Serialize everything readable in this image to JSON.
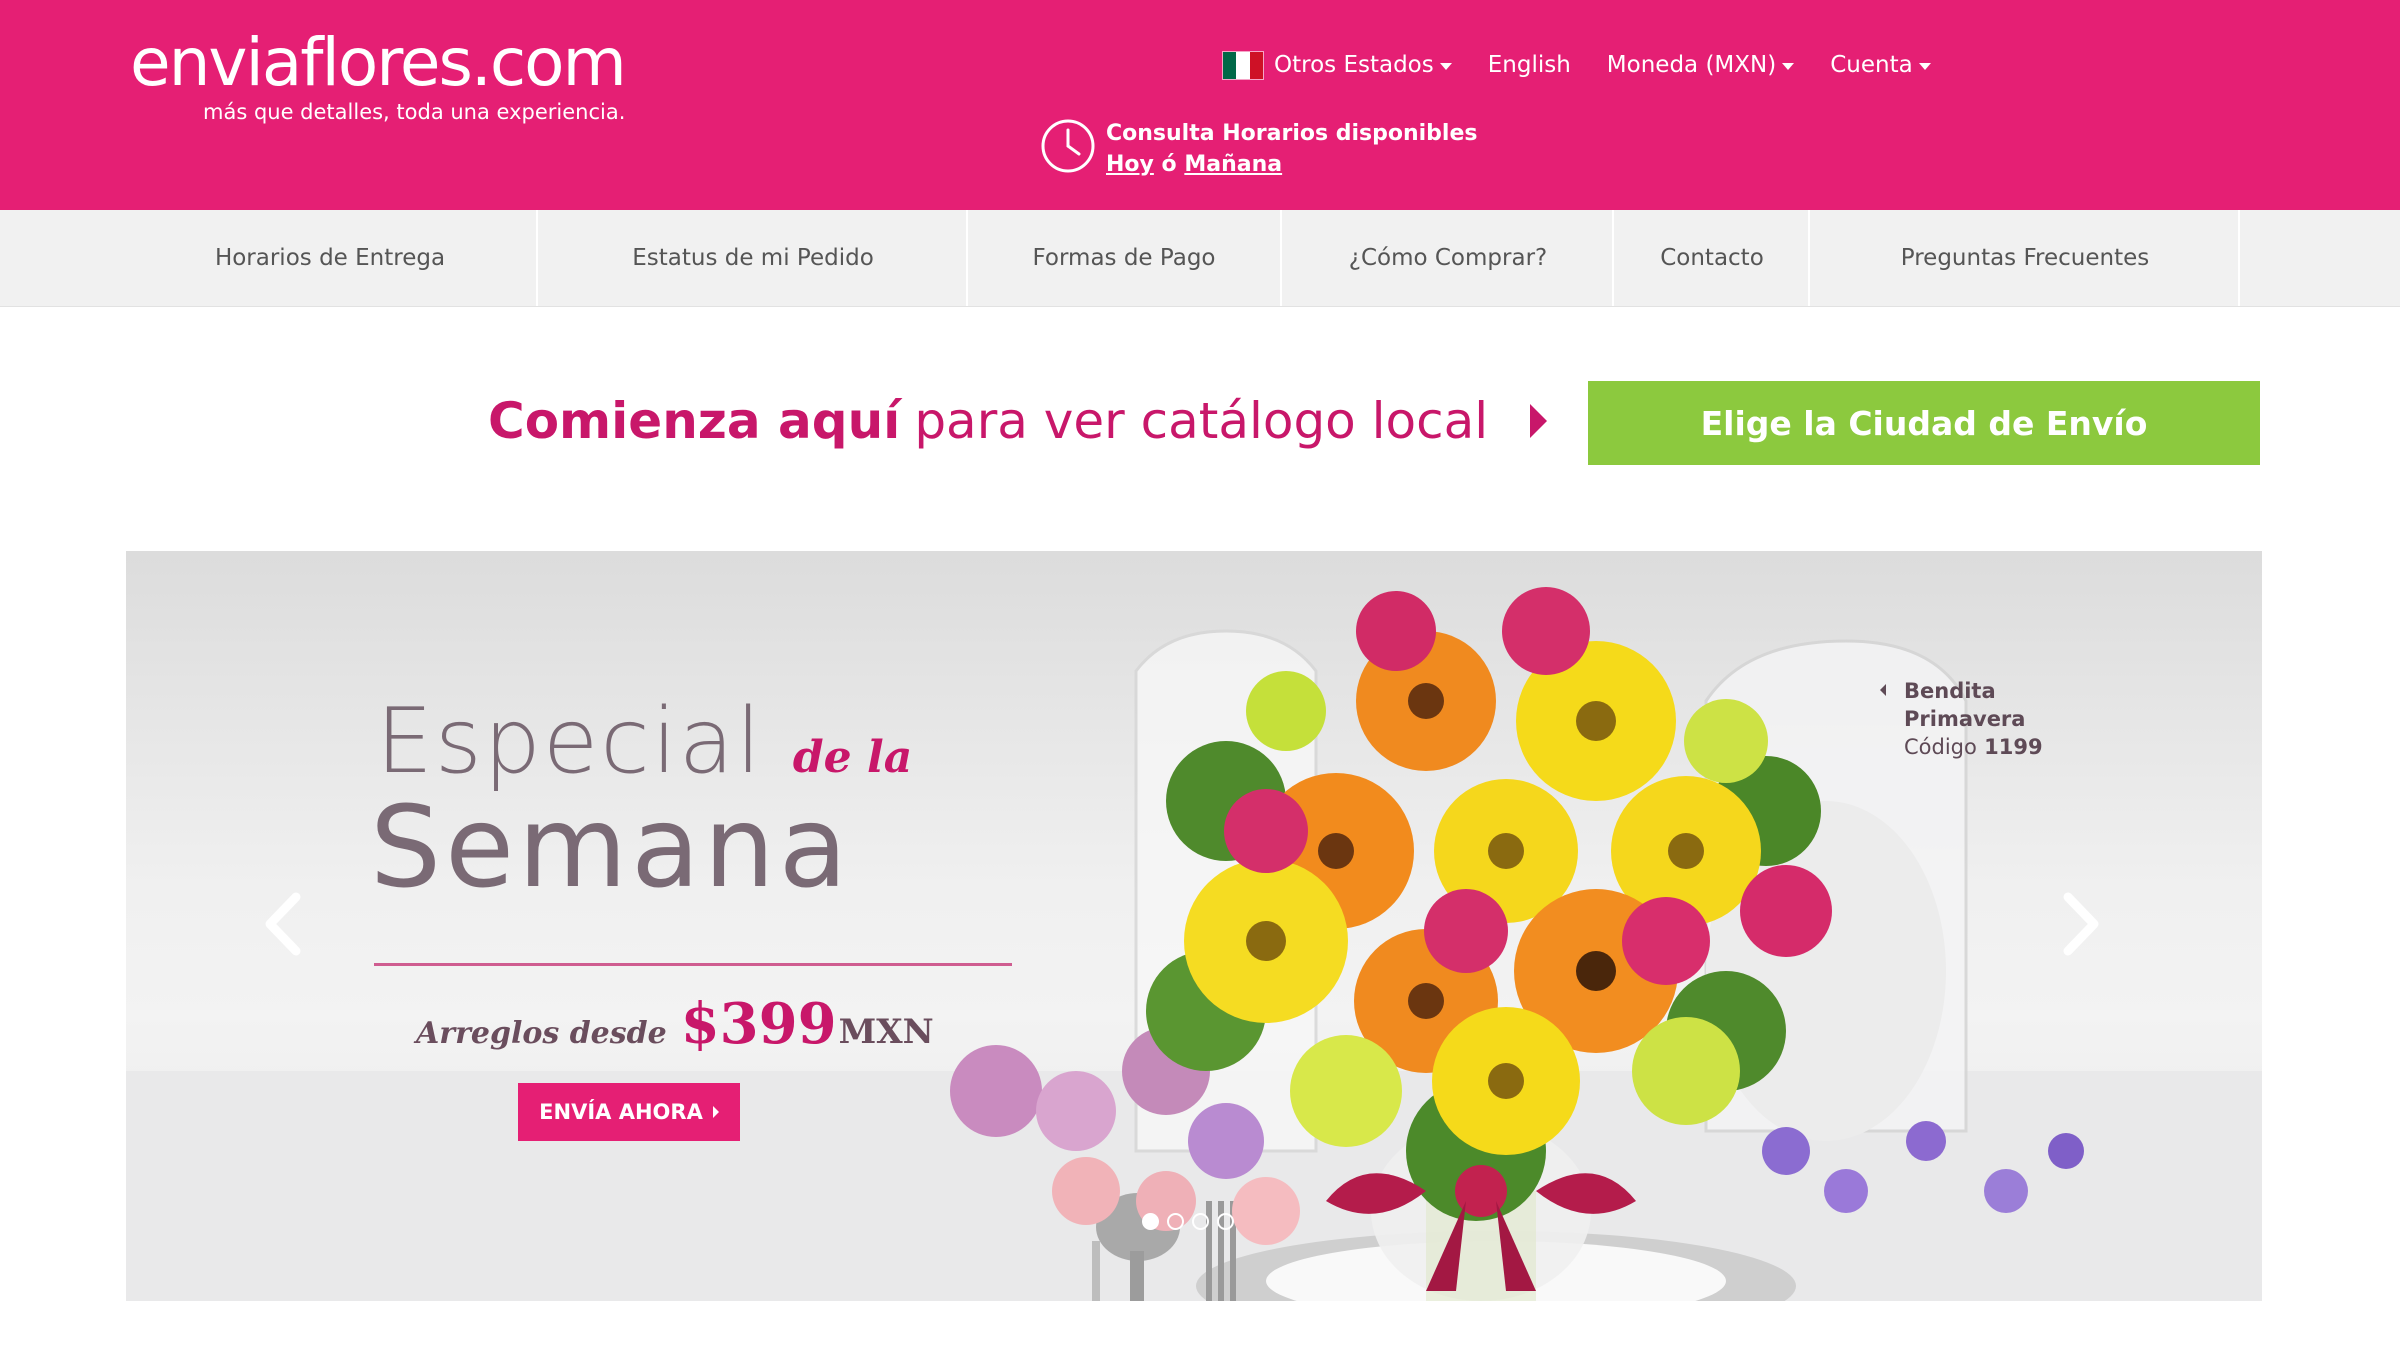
{
  "header": {
    "logo_text": "enviaflores.com",
    "tagline": "más que detalles, toda una experiencia.",
    "topnav": [
      {
        "label": "Otros Estados",
        "icon": "mexico-flag-icon",
        "dropdown": true
      },
      {
        "label": "English",
        "dropdown": false
      },
      {
        "label": "Moneda (MXN)",
        "dropdown": true
      },
      {
        "label": "Cuenta",
        "dropdown": true
      }
    ],
    "hours": {
      "line1": "Consulta Horarios disponibles",
      "today": "Hoy",
      "or": "ó",
      "tomorrow": "Mañana",
      "icon": "clock-icon"
    }
  },
  "menu": [
    {
      "label": "Horarios de Entrega"
    },
    {
      "label": "Estatus de mi Pedido"
    },
    {
      "label": "Formas de Pago"
    },
    {
      "label": "¿Cómo Comprar?"
    },
    {
      "label": "Contacto"
    },
    {
      "label": "Preguntas Frecuentes"
    }
  ],
  "start": {
    "bold": "Comienza aquí",
    "rest": "para ver catálogo local",
    "button": "Elige la Ciudad de Envío"
  },
  "hero": {
    "title_line1": "Especial",
    "title_italic": "de la",
    "title_line2": "Semana",
    "price_prefix": "Arreglos desde",
    "price": "$399",
    "currency": "MXN",
    "cta": "ENVÍA AHORA",
    "product": {
      "name_line1": "Bendita",
      "name_line2": "Primavera",
      "code_label": "Código",
      "code": "1199"
    },
    "slides_total": 4,
    "active_slide": 1
  },
  "colors": {
    "brand_pink": "#e51f74",
    "accent_green": "#8cc93e",
    "menu_bg": "#f1f1f1"
  }
}
